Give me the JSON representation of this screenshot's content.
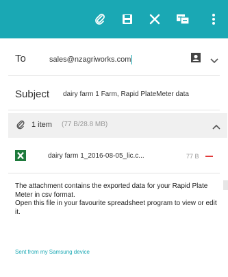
{
  "toolbar": {
    "bg_color": "#1aa8b4",
    "icons": [
      "attach-icon",
      "save-draft-icon",
      "discard-icon",
      "translate-icon",
      "more-options-icon"
    ]
  },
  "to": {
    "label": "To",
    "value": "sales@nzagriworks.com"
  },
  "subject": {
    "label": "Subject",
    "value": "dairy farm 1 Farm, Rapid PlateMeter data"
  },
  "attachments": {
    "count_label": "1 item",
    "size_label": "(77 B/28.8 MB)",
    "file": {
      "name": "dairy farm 1_2016-08-05_lic.c...",
      "size": "77 B"
    }
  },
  "body": {
    "text": "The attachment contains the exported data for your Rapid Plate Meter in csv format.\nOpen this file in your favourite spreadsheet program to view or edit it."
  },
  "signature": "Sent from my Samsung device"
}
